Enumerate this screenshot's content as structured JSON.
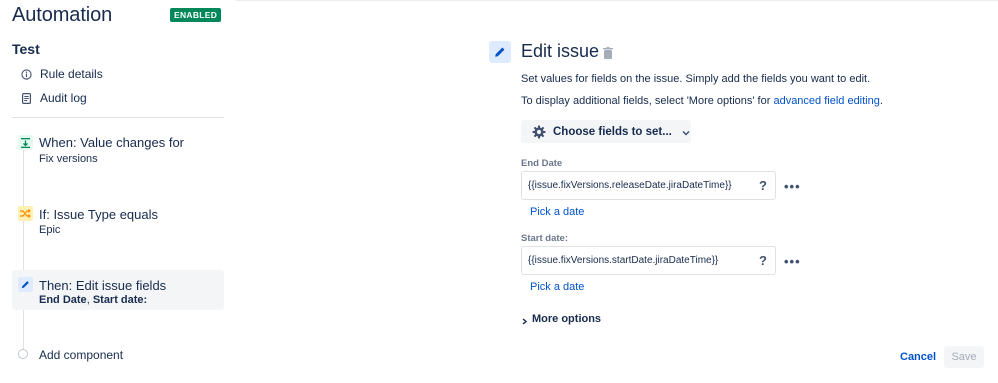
{
  "app": {
    "title": "Automation",
    "status_badge": "ENABLED"
  },
  "rule": {
    "name": "Test",
    "links": [
      {
        "label": "Rule details",
        "icon": "info-icon"
      },
      {
        "label": "Audit log",
        "icon": "document-icon"
      }
    ]
  },
  "steps": [
    {
      "title": "When: Value changes for",
      "subtitle": "Fix versions",
      "icon": "trigger-icon",
      "color": "#e3fcef",
      "icon_color": "#00875a",
      "selected": false
    },
    {
      "title": "If: Issue Type equals",
      "subtitle": "Epic",
      "icon": "shuffle-icon",
      "color": "#fff0b3",
      "icon_color": "#ff8b00",
      "selected": false
    },
    {
      "title": "Then: Edit issue fields",
      "subtitle_parts": [
        "End Date",
        ", ",
        "Start date:"
      ],
      "icon": "pencil-icon",
      "color": "#deebff",
      "icon_color": "#0052cc",
      "selected": true
    }
  ],
  "add_component": "Add component",
  "editor": {
    "title": "Edit issue",
    "description_1": "Set values for fields on the issue. Simply add the fields you want to edit.",
    "description_2_prefix": "To display additional fields, select 'More options' for ",
    "description_2_link": "advanced field editing",
    "description_2_suffix": ".",
    "choose_fields": "Choose fields to set...",
    "fields": [
      {
        "label": "End Date",
        "value": "{{issue.fixVersions.releaseDate.jiraDateTime}}",
        "help": "?",
        "pick": "Pick a date"
      },
      {
        "label": "Start date:",
        "value": "{{issue.fixVersions.startDate.jiraDateTime}}",
        "help": "?",
        "pick": "Pick a date"
      }
    ],
    "more_options": "More options",
    "cancel": "Cancel",
    "save": "Save"
  },
  "colors": {
    "accent": "#0052cc",
    "badge": "#00875a"
  }
}
